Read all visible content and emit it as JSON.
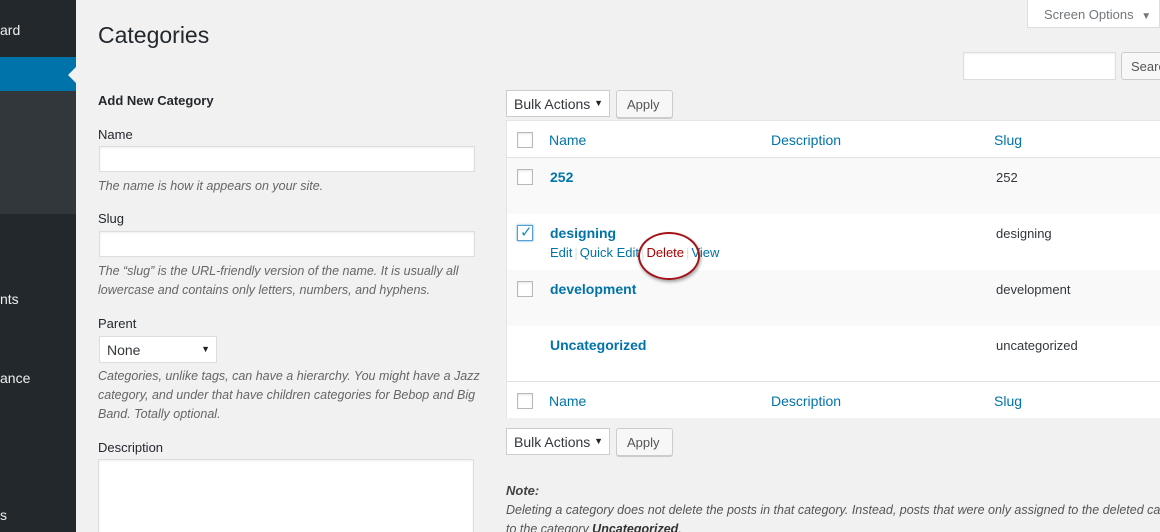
{
  "sidebar": {
    "items": [
      {
        "label": "ard"
      },
      {
        "label": "nts"
      },
      {
        "label": "ance"
      },
      {
        "label": "s"
      }
    ]
  },
  "header": {
    "title": "Categories",
    "screen_options": "Screen Options"
  },
  "search": {
    "button_label": "Searc",
    "value": ""
  },
  "form": {
    "heading": "Add New Category",
    "name_label": "Name",
    "name_value": "",
    "name_hint": "The name is how it appears on your site.",
    "slug_label": "Slug",
    "slug_value": "",
    "slug_hint_line1": "The “slug” is the URL-friendly version of the name. It is usually all",
    "slug_hint_line2": "lowercase and contains only letters, numbers, and hyphens.",
    "parent_label": "Parent",
    "parent_value": "None",
    "parent_hint_line1": "Categories, unlike tags, can have a hierarchy. You might have a Jazz",
    "parent_hint_line2": "category, and under that have children categories for Bebop and Big",
    "parent_hint_line3": "Band. Totally optional.",
    "description_label": "Description"
  },
  "bulk": {
    "select_label": "Bulk Actions",
    "apply_label": "Apply"
  },
  "table": {
    "columns": {
      "name": "Name",
      "description": "Description",
      "slug": "Slug"
    },
    "rows": [
      {
        "name": "252",
        "slug": "252",
        "checked": false
      },
      {
        "name": "designing",
        "slug": "designing",
        "checked": true
      },
      {
        "name": "development",
        "slug": "development",
        "checked": false
      },
      {
        "name": "Uncategorized",
        "slug": "uncategorized",
        "checked": false
      }
    ],
    "row_actions": {
      "edit": "Edit",
      "separator": "|",
      "quick_edit": "Quick Edit",
      "delete": "Delete",
      "view": "View"
    }
  },
  "note": {
    "label": "Note:",
    "line1": "Deleting a category does not delete the posts in that category. Instead, posts that were only assigned to the deleted ca",
    "line2_prefix": "to the category ",
    "line2_bold": "Uncategorized",
    "line2_suffix": "."
  },
  "colors": {
    "link": "#0073aa",
    "danger": "#a00",
    "sidebar_bg": "#23282d",
    "sidebar_active": "#0073aa",
    "annotation_ring": "#a3131a"
  }
}
